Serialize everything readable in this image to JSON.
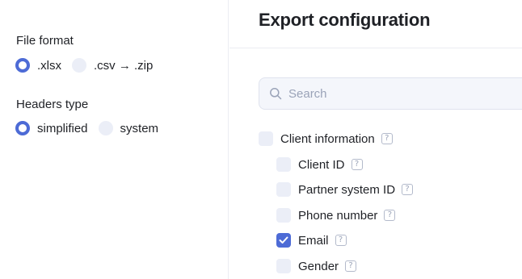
{
  "sidebar": {
    "file_format": {
      "title": "File format",
      "options": [
        {
          "label": ".xlsx",
          "selected": true
        },
        {
          "label": ".csv → .zip",
          "selected": false
        }
      ]
    },
    "headers_type": {
      "title": "Headers type",
      "options": [
        {
          "label": "simplified",
          "selected": true
        },
        {
          "label": "system",
          "selected": false
        }
      ]
    }
  },
  "main": {
    "title": "Export configuration",
    "search": {
      "placeholder": "Search",
      "value": ""
    },
    "tree": {
      "parent": {
        "label": "Client information",
        "checked": false
      },
      "children": [
        {
          "label": "Client ID",
          "checked": false
        },
        {
          "label": "Partner system ID",
          "checked": false
        },
        {
          "label": "Phone number",
          "checked": false
        },
        {
          "label": "Email",
          "checked": true
        },
        {
          "label": "Gender",
          "checked": false
        }
      ]
    }
  },
  "icons": {
    "help": "?",
    "search": "search-icon",
    "check": "check-icon"
  },
  "colors": {
    "accent": "#4d6bd6",
    "control_bg": "#ebeef7",
    "divider": "#ebedf2",
    "text": "#1f2126",
    "placeholder": "#9aa3b8"
  }
}
